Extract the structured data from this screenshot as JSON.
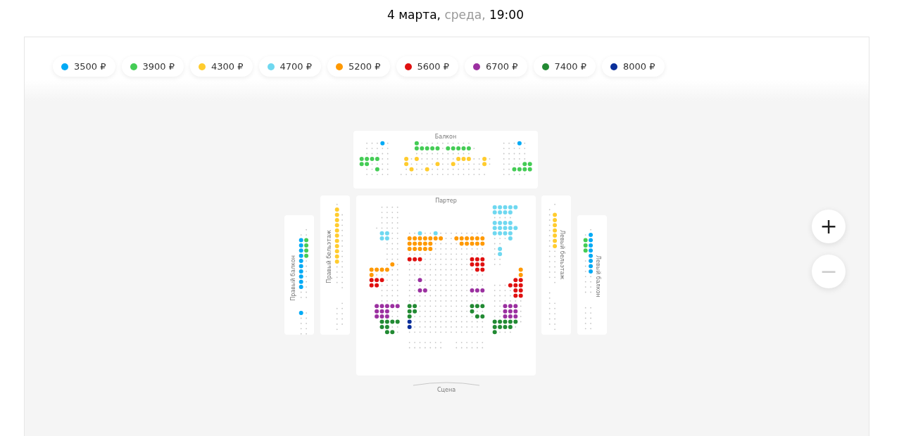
{
  "header": {
    "date": "4 марта,",
    "weekday": "среда,",
    "time": "19:00"
  },
  "prices": [
    {
      "label": "3500 ₽",
      "color": "#00aaf5"
    },
    {
      "label": "3900 ₽",
      "color": "#44cc55"
    },
    {
      "label": "4300 ₽",
      "color": "#ffcc2e"
    },
    {
      "label": "4700 ₽",
      "color": "#6fd8f0"
    },
    {
      "label": "5200 ₽",
      "color": "#ff9900"
    },
    {
      "label": "5600 ₽",
      "color": "#e01010"
    },
    {
      "label": "6700 ₽",
      "color": "#9b30a0"
    },
    {
      "label": "7400 ₽",
      "color": "#228a33"
    },
    {
      "label": "8000 ₽",
      "color": "#0a2f9a"
    }
  ],
  "map": {
    "balcony": {
      "title": "Балкон"
    },
    "parterre": {
      "title": "Партер"
    },
    "side_sections": [
      {
        "title": "Правый балкон",
        "kind": "left"
      },
      {
        "title": "Правый бельэтаж",
        "kind": "left"
      },
      {
        "title": "Левый бельэтаж",
        "kind": "right"
      },
      {
        "title": "Левый балкон",
        "kind": "right"
      }
    ],
    "stage": "Сцена"
  },
  "zoom": {
    "zoom_in": "+",
    "zoom_out": "−",
    "zoom_out_disabled": true
  }
}
